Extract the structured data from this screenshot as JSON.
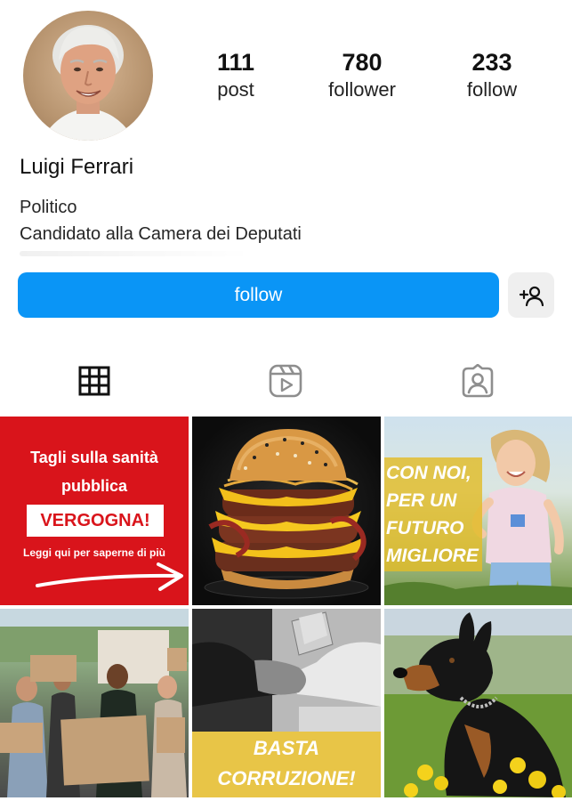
{
  "profile": {
    "name": "Luigi Ferrari",
    "bio_line1": "Politico",
    "bio_line2": "Candidato alla Camera dei Deputati"
  },
  "stats": [
    {
      "value": "111",
      "label": "post"
    },
    {
      "value": "780",
      "label": "follower"
    },
    {
      "value": "233",
      "label": "follow"
    }
  ],
  "actions": {
    "follow_label": "follow",
    "add_icon": "add-user-icon"
  },
  "tabs": [
    {
      "icon": "grid-icon",
      "active": true
    },
    {
      "icon": "reels-icon",
      "active": false
    },
    {
      "icon": "tagged-icon",
      "active": false
    }
  ],
  "posts": {
    "p1": {
      "line1": "Tagli sulla sanità",
      "line2": "pubblica",
      "badge": "VERGOGNA!",
      "cta": "Leggi qui per saperne di più"
    },
    "p3": {
      "line1": "CON NOI,",
      "line2": "PER UN",
      "line3": "FUTURO",
      "line4": "MIGLIORE"
    },
    "p5": {
      "line1": "BASTA",
      "line2": "CORRUZIONE!"
    }
  },
  "colors": {
    "accent_blue": "#0a95f6",
    "post_red": "#d9141b",
    "post_yellow": "#e8c547"
  }
}
